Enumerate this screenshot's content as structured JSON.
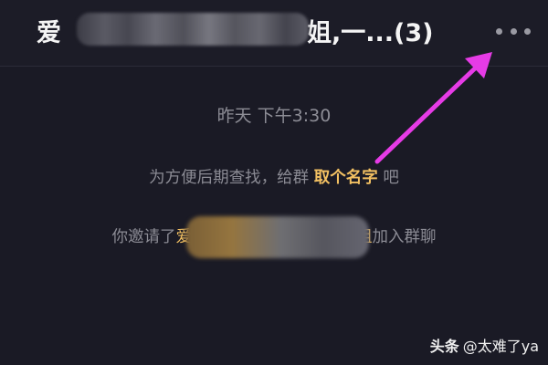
{
  "header": {
    "title_prefix": "爱",
    "title_suffix": "姐,一...(3)",
    "more_icon": "more-dots-icon"
  },
  "chat": {
    "timestamp": "昨天 下午3:30",
    "naming_prompt": {
      "before": "为方便后期查找，给群",
      "link": "取个名字",
      "after": "吧"
    },
    "invite_notice": {
      "before": "你邀请了",
      "name_prefix": "爱",
      "name_suffix": "姐",
      "after": "加入群聊"
    }
  },
  "watermark": {
    "brand": "头条",
    "handle": "@太难了ya"
  },
  "colors": {
    "background": "#1a1a25",
    "header_text": "#f5f5f5",
    "muted_text": "#8b8b94",
    "link": "#f2c062",
    "annotation_arrow": "#e63be6"
  }
}
